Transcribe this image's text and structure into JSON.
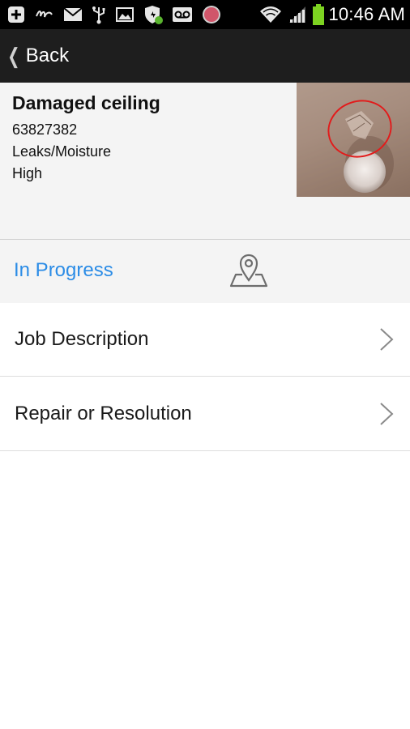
{
  "status_bar": {
    "time": "10:46 AM",
    "left_icons": [
      "add-icon",
      "virgin-icon",
      "mail-icon",
      "usb-icon",
      "image-icon",
      "shield-icon",
      "voicemail-icon",
      "record-icon"
    ],
    "right_icons": [
      "wifi-icon",
      "signal-icon",
      "battery-icon"
    ]
  },
  "action_bar": {
    "back_label": "Back"
  },
  "job": {
    "title": "Damaged ceiling",
    "number": "63827382",
    "category": "Leaks/Moisture",
    "priority": "High"
  },
  "status": {
    "label": "In Progress",
    "color": "#2b8ce6"
  },
  "menu": {
    "items": [
      {
        "label": "Job Description"
      },
      {
        "label": "Repair or Resolution"
      }
    ]
  },
  "colors": {
    "status_bar_bg": "#000000",
    "action_bar_bg": "#1e1e1e",
    "battery": "#7dd321"
  }
}
